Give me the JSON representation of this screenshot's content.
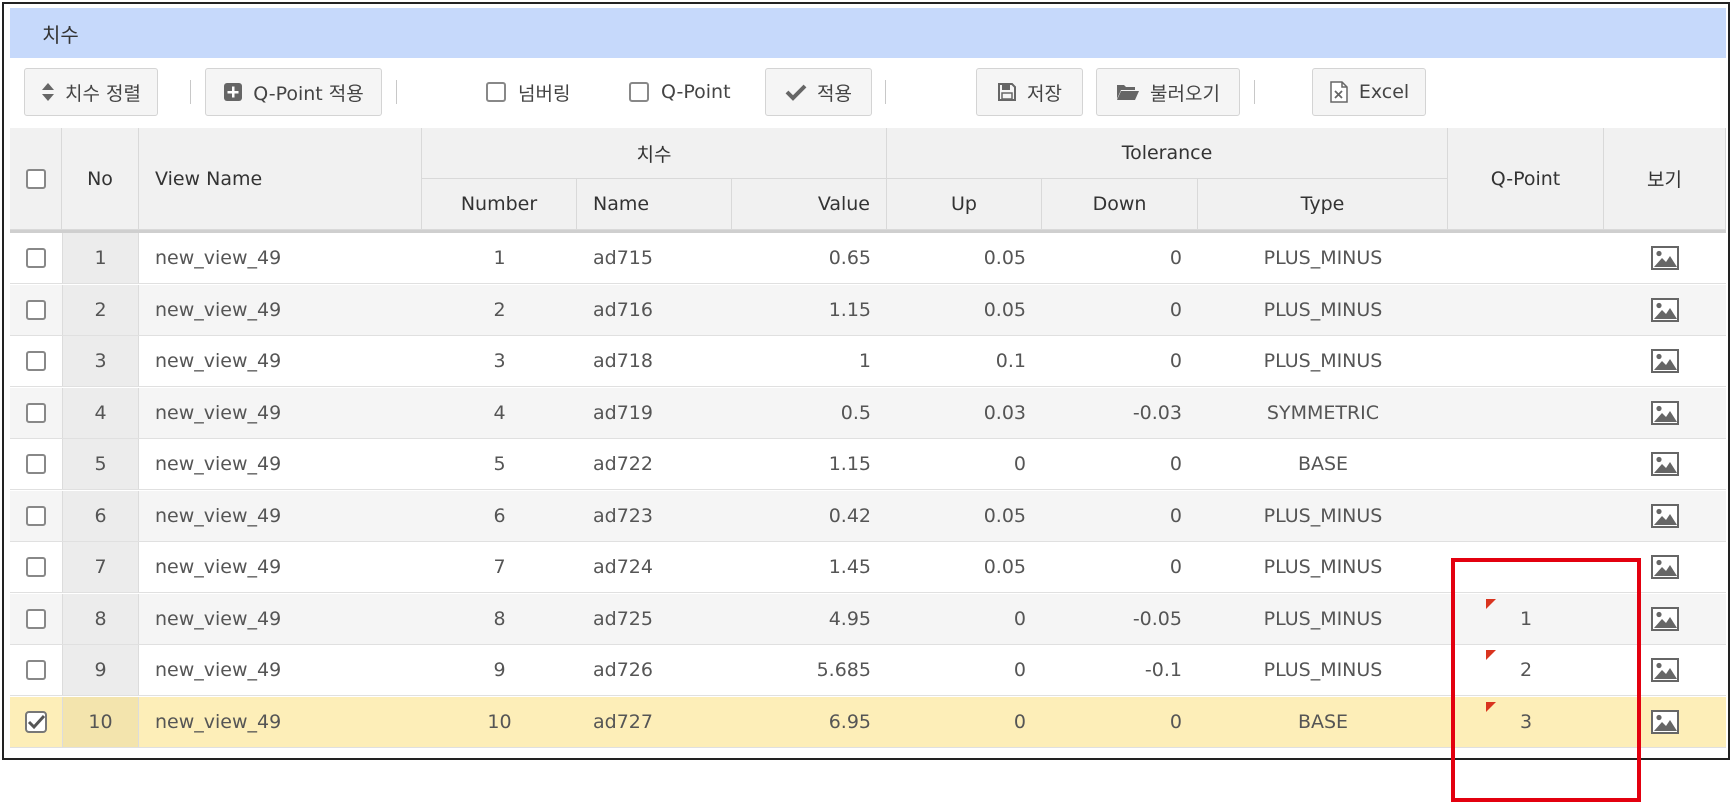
{
  "panel": {
    "title": "치수"
  },
  "toolbar": {
    "sort_label": "치수 정렬",
    "qpoint_apply_label": "Q-Point 적용",
    "numbering_label": "넘버링",
    "qpoint_check_label": "Q-Point",
    "apply_label": "적용",
    "save_label": "저장",
    "load_label": "불러오기",
    "excel_label": "Excel"
  },
  "table": {
    "headers": {
      "no": "No",
      "view_name": "View Name",
      "dimension_group": "치수",
      "number": "Number",
      "name": "Name",
      "value": "Value",
      "tolerance_group": "Tolerance",
      "up": "Up",
      "down": "Down",
      "type": "Type",
      "qpoint": "Q-Point",
      "view": "보기"
    },
    "rows": [
      {
        "checked": false,
        "no": "1",
        "view_name": "new_view_49",
        "number": "1",
        "name": "ad715",
        "value": "0.65",
        "up": "0.05",
        "down": "0",
        "type": "PLUS_MINUS",
        "qpoint": "",
        "marker": false,
        "selected": false
      },
      {
        "checked": false,
        "no": "2",
        "view_name": "new_view_49",
        "number": "2",
        "name": "ad716",
        "value": "1.15",
        "up": "0.05",
        "down": "0",
        "type": "PLUS_MINUS",
        "qpoint": "",
        "marker": false,
        "selected": false
      },
      {
        "checked": false,
        "no": "3",
        "view_name": "new_view_49",
        "number": "3",
        "name": "ad718",
        "value": "1",
        "up": "0.1",
        "down": "0",
        "type": "PLUS_MINUS",
        "qpoint": "",
        "marker": false,
        "selected": false
      },
      {
        "checked": false,
        "no": "4",
        "view_name": "new_view_49",
        "number": "4",
        "name": "ad719",
        "value": "0.5",
        "up": "0.03",
        "down": "-0.03",
        "type": "SYMMETRIC",
        "qpoint": "",
        "marker": false,
        "selected": false
      },
      {
        "checked": false,
        "no": "5",
        "view_name": "new_view_49",
        "number": "5",
        "name": "ad722",
        "value": "1.15",
        "up": "0",
        "down": "0",
        "type": "BASE",
        "qpoint": "",
        "marker": false,
        "selected": false
      },
      {
        "checked": false,
        "no": "6",
        "view_name": "new_view_49",
        "number": "6",
        "name": "ad723",
        "value": "0.42",
        "up": "0.05",
        "down": "0",
        "type": "PLUS_MINUS",
        "qpoint": "",
        "marker": false,
        "selected": false
      },
      {
        "checked": false,
        "no": "7",
        "view_name": "new_view_49",
        "number": "7",
        "name": "ad724",
        "value": "1.45",
        "up": "0.05",
        "down": "0",
        "type": "PLUS_MINUS",
        "qpoint": "",
        "marker": false,
        "selected": false
      },
      {
        "checked": false,
        "no": "8",
        "view_name": "new_view_49",
        "number": "8",
        "name": "ad725",
        "value": "4.95",
        "up": "0",
        "down": "-0.05",
        "type": "PLUS_MINUS",
        "qpoint": "1",
        "marker": true,
        "selected": false
      },
      {
        "checked": false,
        "no": "9",
        "view_name": "new_view_49",
        "number": "9",
        "name": "ad726",
        "value": "5.685",
        "up": "0",
        "down": "-0.1",
        "type": "PLUS_MINUS",
        "qpoint": "2",
        "marker": true,
        "selected": false
      },
      {
        "checked": true,
        "no": "10",
        "view_name": "new_view_49",
        "number": "10",
        "name": "ad727",
        "value": "6.95",
        "up": "0",
        "down": "0",
        "type": "BASE",
        "qpoint": "3",
        "marker": true,
        "selected": true
      }
    ]
  },
  "icons": {
    "sort": "sort-icon",
    "add": "plus-square-icon",
    "check": "checkmark-icon",
    "save": "floppy-disk-icon",
    "load": "folder-open-icon",
    "excel": "excel-file-icon",
    "view": "image-icon"
  },
  "colors": {
    "title_bar": "#c6d9fb",
    "selected_row": "#fdeeb8",
    "highlight_box": "#e3000f",
    "qpoint_marker": "#d9341f"
  }
}
